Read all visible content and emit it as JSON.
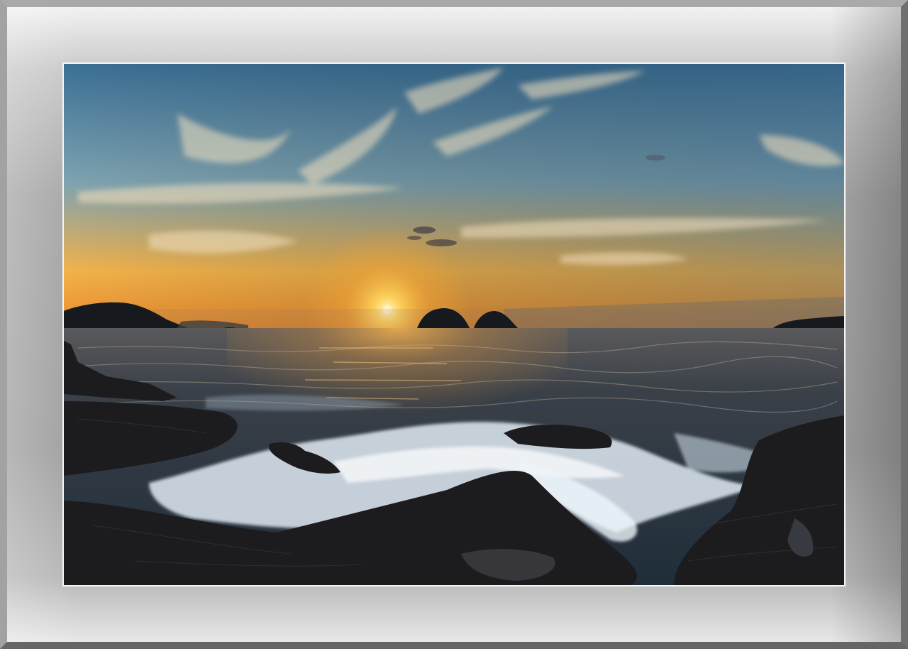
{
  "scene": {
    "subject": "photo-sunset-seascape",
    "colors": {
      "sky_top": "#3b6f95",
      "sky_mid": "#7fa3b0",
      "sky_glow": "#f2b24a",
      "horizon": "#e98a2a",
      "sun": "#fff4c2",
      "sea_dark": "#1f2d3a",
      "sea_glint": "#d89a4a",
      "foam": "#dfeaf3",
      "rock": "#1c1c1e"
    }
  }
}
